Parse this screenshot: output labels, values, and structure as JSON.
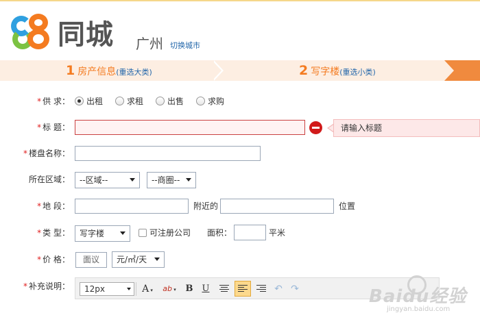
{
  "header": {
    "logo_number": "58",
    "logo_text": "同城",
    "city": "广州",
    "switch_city": "切换城市"
  },
  "steps": [
    {
      "num": "1",
      "label": "房产信息",
      "action": "(重选大类)"
    },
    {
      "num": "2",
      "label": "写字楼",
      "action": "(重选小类)"
    }
  ],
  "form": {
    "supply": {
      "label": "供 求：",
      "options": [
        "出租",
        "求租",
        "出售",
        "求购"
      ],
      "selected": "出租"
    },
    "title": {
      "label": "标 题：",
      "value": "",
      "error": "请输入标题"
    },
    "building": {
      "label": "楼盘名称：",
      "value": ""
    },
    "area": {
      "label": "所在区域：",
      "district": "--区域--",
      "circle": "--商圈--"
    },
    "location": {
      "label": "地 段：",
      "near": "附近的",
      "position": "位置"
    },
    "type": {
      "label": "类 型：",
      "value": "写字楼",
      "register_company": "可注册公司",
      "size_label": "面积：",
      "size_unit": "平米"
    },
    "price": {
      "label": "价 格：",
      "placeholder": "面议",
      "unit": "元/㎡/天"
    },
    "description": {
      "label": "补充说明：",
      "font_size": "12px"
    }
  },
  "toolbar": {
    "font_color": "A",
    "highlight": "ab",
    "bold": "B",
    "underline": "U",
    "undo": "↶",
    "redo": "↷"
  },
  "watermark": {
    "main": "Baidu经验",
    "sub": "jingyan.baidu.com"
  },
  "colors": {
    "accent": "#f47b20",
    "link": "#2266aa",
    "error": "#d11a1a",
    "required": "#e02020"
  }
}
